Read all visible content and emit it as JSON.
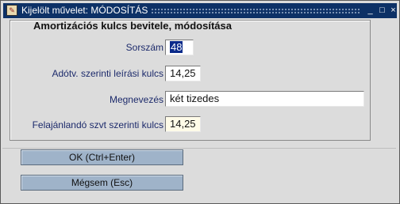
{
  "window": {
    "title": "Kijelölt művelet: MÓDOSÍTÁS",
    "controls": {
      "minimize": "_",
      "maximize": "□",
      "close": "×"
    }
  },
  "form": {
    "title": "Amortizációs kulcs bevitele, módosítása",
    "fields": {
      "sorszam": {
        "label": "Sorszám",
        "value": "48"
      },
      "adotv": {
        "label": "Adótv. szerinti leírási kulcs",
        "value": "14,25"
      },
      "megnevezes": {
        "label": "Megnevezés",
        "value": "két tizedes"
      },
      "felajanlando": {
        "label": "Felajánlandó szvt szerinti kulcs",
        "value": "14,25"
      }
    }
  },
  "buttons": {
    "ok": "OK (Ctrl+Enter)",
    "cancel": "Mégsem (Esc)"
  },
  "colors": {
    "titlebar": "#0d3166",
    "label": "#1c2a6b",
    "button": "#9fb3c9",
    "selection": "#0a2a8a"
  }
}
